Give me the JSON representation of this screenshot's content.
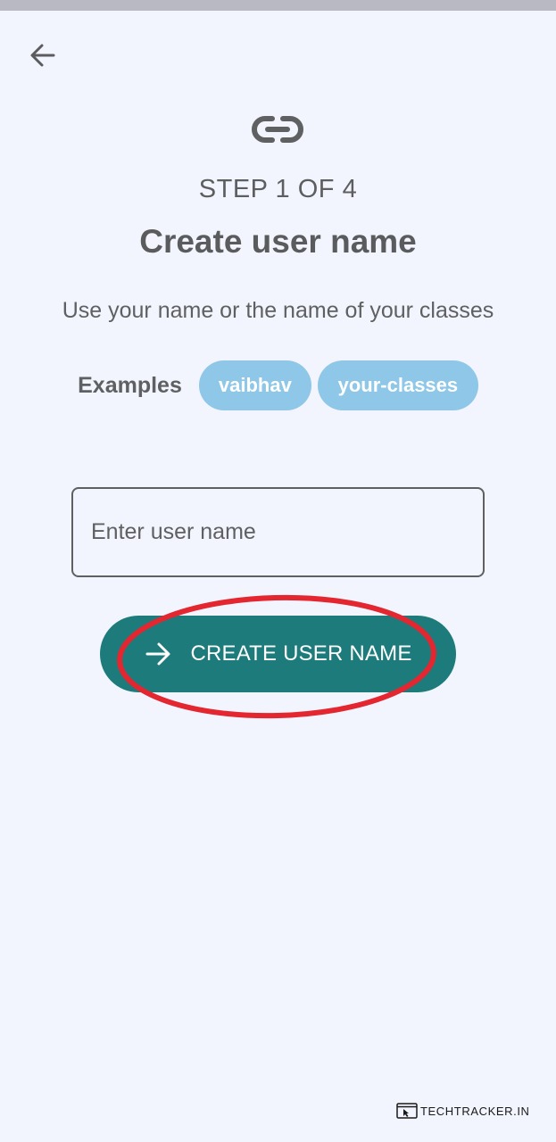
{
  "header": {
    "back_icon": "arrow-left-icon"
  },
  "hero": {
    "icon": "link-icon",
    "step_label": "STEP 1 OF 4",
    "title": "Create user name",
    "subtitle": "Use your name or the name of your classes"
  },
  "examples": {
    "label": "Examples",
    "chips": [
      "vaibhav",
      "your-classes"
    ]
  },
  "form": {
    "username_value": "",
    "username_placeholder": "Enter user name",
    "submit_label": "CREATE USER NAME",
    "submit_icon": "arrow-right-icon"
  },
  "annotation": {
    "shape": "ellipse",
    "color": "#e3262f",
    "target": "create-user-name-button"
  },
  "watermark": {
    "text": "TECHTRACKER.IN"
  },
  "colors": {
    "background": "#f2f5fd",
    "primary": "#1e7b7c",
    "chip": "#8ec7e7",
    "text": "#5f6062"
  }
}
